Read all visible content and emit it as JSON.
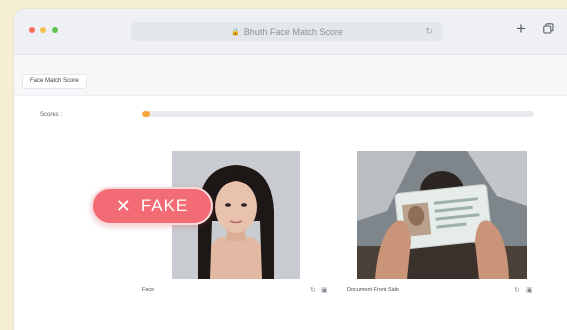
{
  "window": {
    "url_title": "Bhuth Face Match Score",
    "new_tab_symbol": "+"
  },
  "page": {
    "tab_label": "Face Match Score",
    "score": {
      "label": "Scores :",
      "value_fraction": 0.02,
      "bar_color": "#f5a33a"
    },
    "images": [
      {
        "caption": "Face"
      },
      {
        "caption": "Document Front Side"
      }
    ]
  },
  "badge": {
    "icon": "x-icon",
    "label": "FAKE",
    "color": "#f36b74"
  }
}
